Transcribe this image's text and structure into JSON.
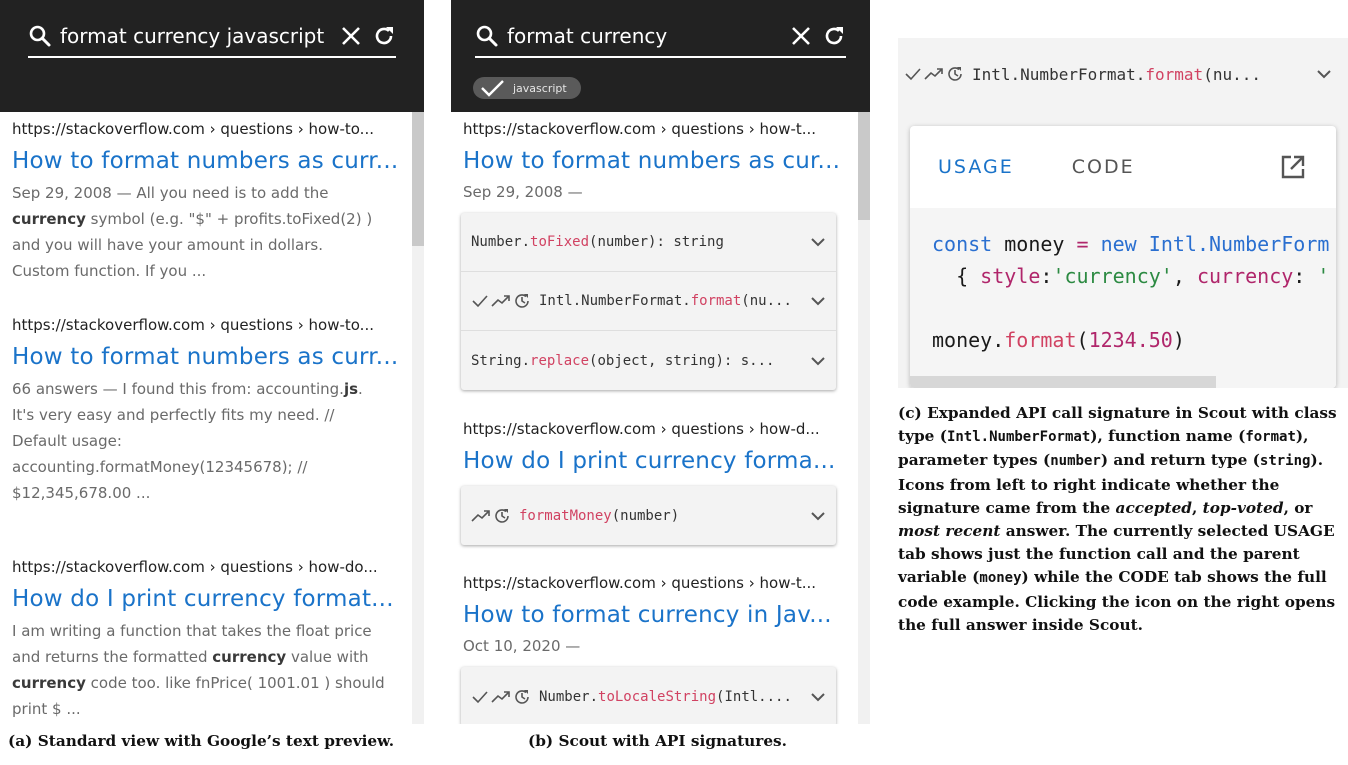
{
  "panel_a": {
    "query": "format currency javascript",
    "results": [
      {
        "url": "https://stackoverflow.com › questions › how-to...",
        "title": "How to format numbers as curr...",
        "snippet": [
          "Sep 29, 2008 — All you need is to add the",
          "currency",
          " symbol (e.g. \"$\" + profits.toFixed(2) )",
          "and you will have your amount in dollars.",
          "Custom function. If you ..."
        ]
      },
      {
        "url": "https://stackoverflow.com › questions › how-to...",
        "title": "How to format numbers as curr...",
        "snippet": [
          "66 answers — I found this from: accounting.",
          "js",
          ".",
          "It's very easy and perfectly fits my need. //",
          "Default usage:",
          "accounting.formatMoney(12345678); //",
          "$12,345,678.00 ..."
        ]
      },
      {
        "url": "https://stackoverflow.com › questions › how-do...",
        "title": "How do I print currency format...",
        "snippet": [
          "I am writing a function that takes the float price",
          "and returns the formatted ",
          "currency",
          " value with",
          "currency",
          " code too. like fnPrice( 1001.01 ) should",
          "print $ ..."
        ]
      }
    ]
  },
  "panel_b": {
    "query": "format currency",
    "filter_chip": "javascript",
    "results": [
      {
        "url": "https://stackoverflow.com › questions › how-t...",
        "title": "How to format numbers as cur...",
        "date": "Sep 29, 2008 —",
        "signatures": [
          {
            "prefix": "Number.",
            "fn": "toFixed",
            "suffix": "(number): string",
            "badges": []
          },
          {
            "prefix": "Intl.NumberFormat.",
            "fn": "format",
            "suffix": "(nu...",
            "badges": [
              "accepted-icon",
              "top-voted-icon",
              "most-recent-icon"
            ]
          },
          {
            "prefix": "String.",
            "fn": "replace",
            "suffix": "(object, string): s...",
            "badges": []
          }
        ]
      },
      {
        "url": "https://stackoverflow.com › questions › how-d...",
        "title": "How do I print currency forma...",
        "date": "",
        "signatures": [
          {
            "prefix": "",
            "fn": "formatMoney",
            "suffix": "(number)",
            "badges": [
              "top-voted-icon",
              "most-recent-icon"
            ]
          }
        ]
      },
      {
        "url": "https://stackoverflow.com › questions › how-t...",
        "title": "How to format currency in Jav...",
        "date": "Oct 10, 2020 —",
        "signatures": [
          {
            "prefix": "Number.",
            "fn": "toLocaleString",
            "suffix": "(Intl....",
            "badges": [
              "accepted-icon",
              "top-voted-icon",
              "most-recent-icon"
            ]
          }
        ]
      }
    ]
  },
  "panel_c": {
    "signature": {
      "prefix": "Intl.NumberFormat.",
      "fn": "format",
      "suffix": "(nu..."
    },
    "tabs": {
      "usage": "USAGE",
      "code": "CODE"
    },
    "code_lines": {
      "l1_kw": "const",
      "l1_var": " money ",
      "l1_op": "=",
      "l1_new": " new ",
      "l1_cls": "Intl.NumberForm",
      "l2_open": "  { ",
      "l2_prop": "style",
      "l2_colon": ":",
      "l2_str": "'currency'",
      "l2_comma": ", ",
      "l2_prop2": "currency",
      "l2_colon2": ": ",
      "l2_tail": "'",
      "l4_var": "money",
      "l4_dot": ".",
      "l4_fn": "format",
      "l4_open": "(",
      "l4_num": "1234.50",
      "l4_close": ")"
    }
  },
  "captions": {
    "a": "(a) Standard view with Google’s text preview.",
    "b": "(b) Scout with API signatures.",
    "c_parts": [
      "(c) Expanded API call signature in Scout with class type (",
      "Intl.NumberFormat",
      "), function name (",
      "format",
      "), parameter types (",
      "number",
      ") and return type (",
      "string",
      "). Icons from left to right indicate whether the signature came from the ",
      "accepted",
      ", ",
      "top-voted",
      ", or ",
      "most recent",
      " answer. The currently selected USAGE tab shows just the function call and the parent variable (",
      "money",
      ") while the CODE tab shows the full code example. Clicking the icon on the right opens the full answer inside Scout."
    ]
  },
  "colors": {
    "link": "#1a73c9",
    "function": "#d14262",
    "dark_bar": "#222222"
  }
}
